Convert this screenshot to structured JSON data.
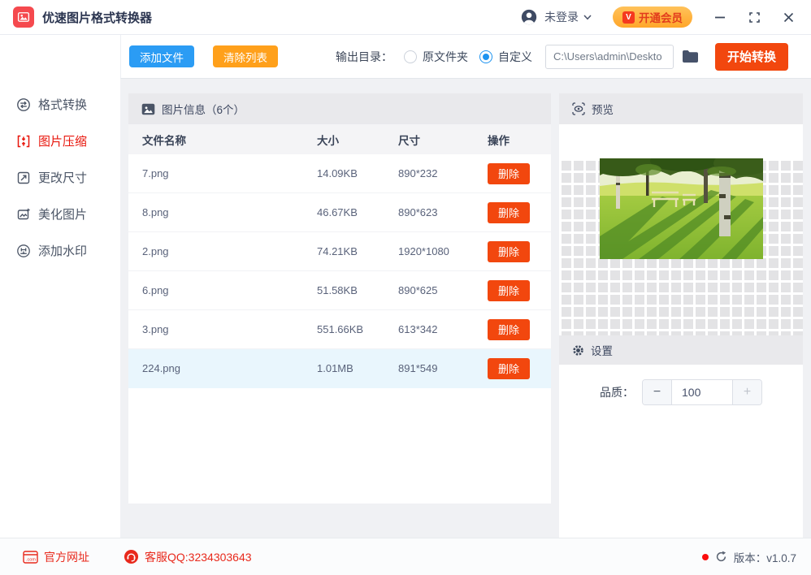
{
  "window": {
    "title": "优速图片格式转换器",
    "login_label": "未登录",
    "membership_label": "开通会员",
    "vip_badge": "V"
  },
  "toolbar": {
    "add_files": "添加文件",
    "clear_list": "清除列表",
    "output_dir_label": "输出目录：",
    "radio_original": "原文件夹",
    "radio_custom": "自定义",
    "path_value": "C:\\Users\\admin\\Deskto",
    "start_convert": "开始转换"
  },
  "sidebar": {
    "items": [
      {
        "label": "格式转换",
        "active": false
      },
      {
        "label": "图片压缩",
        "active": true
      },
      {
        "label": "更改尺寸",
        "active": false
      },
      {
        "label": "美化图片",
        "active": false
      },
      {
        "label": "添加水印",
        "active": false
      }
    ]
  },
  "table": {
    "title": "图片信息（6个）",
    "columns": {
      "name": "文件名称",
      "size": "大小",
      "dims": "尺寸",
      "ops": "操作"
    },
    "delete_label": "删除",
    "rows": [
      {
        "name": "7.png",
        "size": "14.09KB",
        "dims": "890*232",
        "selected": false
      },
      {
        "name": "8.png",
        "size": "46.67KB",
        "dims": "890*623",
        "selected": false
      },
      {
        "name": "2.png",
        "size": "74.21KB",
        "dims": "1920*1080",
        "selected": false
      },
      {
        "name": "6.png",
        "size": "51.58KB",
        "dims": "890*625",
        "selected": false
      },
      {
        "name": "3.png",
        "size": "551.66KB",
        "dims": "613*342",
        "selected": false
      },
      {
        "name": "224.png",
        "size": "1.01MB",
        "dims": "891*549",
        "selected": true
      }
    ]
  },
  "preview": {
    "title": "预览"
  },
  "settings": {
    "title": "设置",
    "quality_label": "品质：",
    "quality_value": "100",
    "minus_label": "−",
    "plus_label": "+"
  },
  "footer": {
    "website": "官方网址",
    "qq": "客服QQ:3234303643",
    "version": "版本：v1.0.7"
  },
  "colors": {
    "accent_red": "#f2470e",
    "active_red": "#e8160c",
    "accent_blue": "#2b9cf4",
    "accent_orange": "#ffa01b",
    "membership_orange": "#ffa629",
    "selected_row": "#e9f6fd"
  }
}
